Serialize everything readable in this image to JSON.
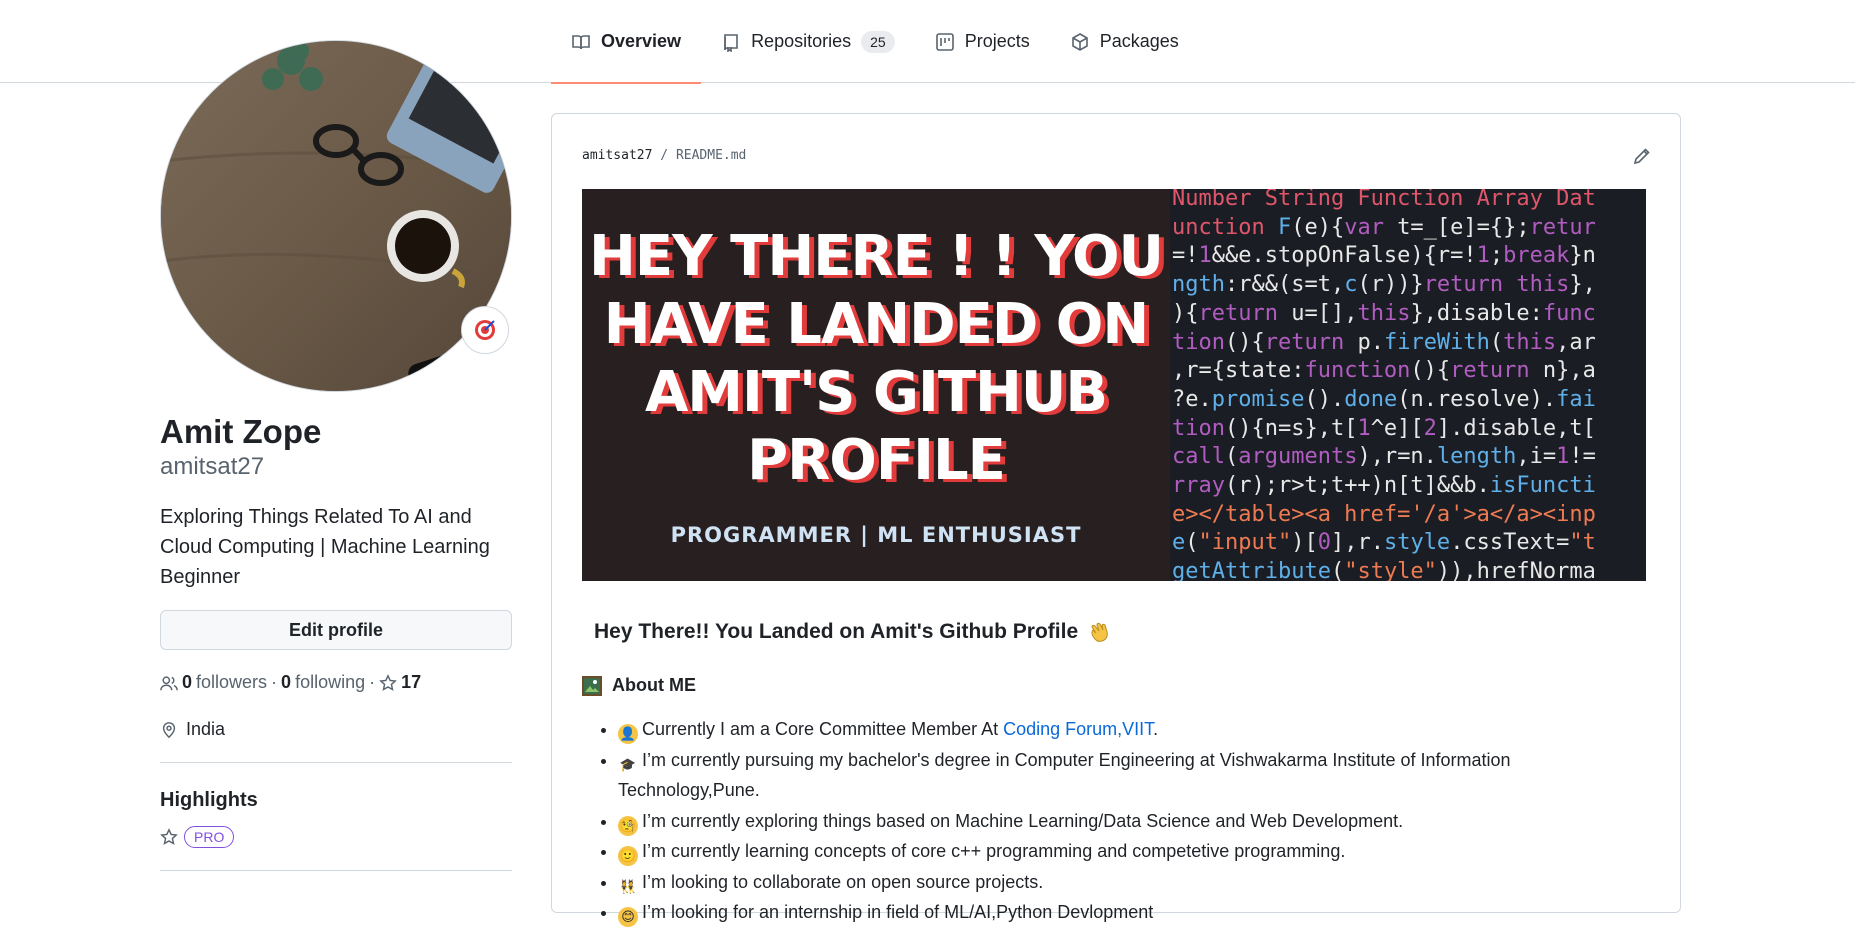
{
  "tabs": [
    {
      "label": "Overview",
      "icon": "book-icon",
      "active": true
    },
    {
      "label": "Repositories",
      "icon": "repo-icon",
      "count": "25"
    },
    {
      "label": "Projects",
      "icon": "project-icon"
    },
    {
      "label": "Packages",
      "icon": "package-icon"
    }
  ],
  "profile": {
    "name": "Amit Zope",
    "login": "amitsat27",
    "bio": "Exploring Things Related To AI and Cloud Computing | Machine Learning Beginner",
    "edit_label": "Edit profile",
    "followers_count": "0",
    "followers_label": "followers",
    "following_count": "0",
    "following_label": "following",
    "stars": "17",
    "location": "India",
    "highlights_title": "Highlights",
    "pro_label": "PRO"
  },
  "readme": {
    "owner": "amitsat27",
    "separator": "/",
    "file": "README.md",
    "banner": {
      "lines": [
        "HEY THERE ! !  YOU",
        "HAVE LANDED ON",
        "AMIT'S GITHUB",
        "PROFILE"
      ],
      "subtitle": "PROGRAMMER |  ML ENTHUSIAST"
    },
    "heading": "Hey There!! You Landed on Amit's Github Profile",
    "about_title": "About ME",
    "items": [
      {
        "prefix": "Currently I am a Core Committee Member At ",
        "link": "Coding Forum,VIIT",
        "suffix": "."
      },
      {
        "prefix": "I’m currently pursuing my bachelor's degree in Computer Engineering at Vishwakarma Institute of Information Technology,Pune.",
        "link": "",
        "suffix": ""
      },
      {
        "prefix": "I’m currently exploring things based on Machine Learning/Data Science and Web Development.",
        "link": "",
        "suffix": ""
      },
      {
        "prefix": "I’m currently learning concepts of core c++ programming and competetive programming.",
        "link": "",
        "suffix": ""
      },
      {
        "prefix": "I’m looking to collaborate on open source projects.",
        "link": "",
        "suffix": ""
      },
      {
        "prefix": "I’m looking for an internship in field of ML/AI,Python Devlopment",
        "link": "",
        "suffix": ""
      }
    ]
  },
  "colors": {
    "accent": "#fd8c73",
    "link": "#0969da",
    "pro": "#8250df"
  }
}
